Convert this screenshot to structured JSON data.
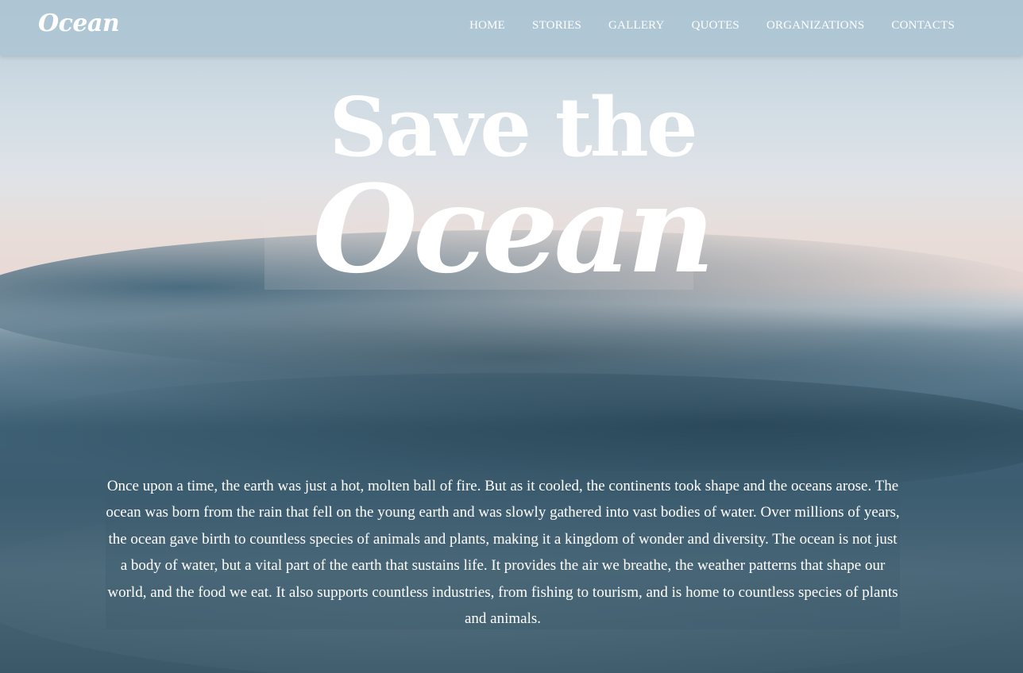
{
  "brand": {
    "logo_text": "Ocean"
  },
  "nav": {
    "items": [
      {
        "label": "HOME"
      },
      {
        "label": "STORIES"
      },
      {
        "label": "GALLERY"
      },
      {
        "label": "QUOTES"
      },
      {
        "label": "ORGANIZATIONS"
      },
      {
        "label": "CONTACTS"
      }
    ]
  },
  "hero": {
    "title_line1": "Save the",
    "title_line2": "Ocean",
    "intro": "Once upon a time, the earth was just a hot, molten ball of fire. But as it cooled, the continents took shape and the oceans arose. The ocean was born from the rain that fell on the young earth and was slowly gathered into vast bodies of water. Over millions of years, the ocean gave birth to countless species of animals and plants, making it a kingdom of wonder and diversity. The ocean is not just a body of water, but a vital part of the earth that sustains life. It provides the air we breathe, the weather patterns that shape our world, and the food we eat. It also supports countless industries, from fishing to tourism, and is home to countless species of plants and animals."
  },
  "colors": {
    "navbar": "#aac3d2",
    "text": "#ffffff",
    "sea": "#3c5c70"
  }
}
